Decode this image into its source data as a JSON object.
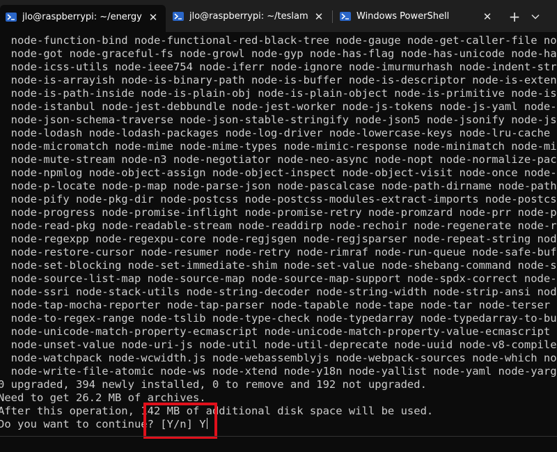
{
  "tabs": [
    {
      "title": "jlo@raspberrypi: ~/energyboa",
      "icon": "powershell-icon",
      "active": true
    },
    {
      "title": "jlo@raspberrypi: ~/teslamate",
      "icon": "powershell-icon",
      "active": false
    },
    {
      "title": "Windows PowerShell",
      "icon": "powershell-icon",
      "active": false
    }
  ],
  "tab_controls": {
    "new_tab": "+",
    "dropdown": "chevron-down-icon",
    "close": "✕"
  },
  "terminal": {
    "lines": [
      "  node-function-bind node-functional-red-black-tree node-gauge node-get-caller-file node-g",
      "  node-got node-graceful-fs node-growl node-gyp node-has-flag node-has-unicode node-has-va",
      "  node-icss-utils node-ieee754 node-iferr node-ignore node-imurmurhash node-indent-string",
      "  node-is-arrayish node-is-binary-path node-is-buffer node-is-descriptor node-is-extendabl",
      "  node-is-path-inside node-is-plain-obj node-is-plain-object node-is-primitive node-is-st",
      "  node-istanbul node-jest-debbundle node-jest-worker node-js-tokens node-js-yaml node-jse",
      "  node-json-schema-traverse node-json-stable-stringify node-json5 node-jsonify node-jsonp",
      "  node-lodash node-lodash-packages node-log-driver node-lowercase-keys node-lru-cache nod",
      "  node-micromatch node-mime node-mime-types node-mimic-response node-minimatch node-minim",
      "  node-mute-stream node-n3 node-negotiator node-neo-async node-nopt node-normalize-packag",
      "  node-npmlog node-object-assign node-object-inspect node-object-visit node-once node-ope",
      "  node-p-locate node-p-map node-parse-json node-pascalcase node-path-dirname node-path-ex",
      "  node-pify node-pkg-dir node-postcss node-postcss-modules-extract-imports node-postcss-m",
      "  node-progress node-promise-inflight node-promise-retry node-promzard node-prr node-pump",
      "  node-read-pkg node-readable-stream node-readdirp node-rechoir node-regenerate node-rege",
      "  node-regexpp node-regexpu-core node-regjsgen node-regjsparser node-repeat-string node-r",
      "  node-restore-cursor node-resumer node-retry node-rimraf node-run-queue node-safe-buffer",
      "  node-set-blocking node-set-immediate-shim node-set-value node-shebang-command node-sheb",
      "  node-source-list-map node-source-map node-source-map-support node-spdx-correct node-spd",
      "  node-ssri node-stack-utils node-string-decoder node-string-width node-strip-ansi node-s",
      "  node-tap-mocha-reporter node-tap-parser node-tapable node-tape node-tar node-terser nod",
      "  node-to-regex-range node-tslib node-type-check node-typedarray node-typedarray-to-buffe",
      "  node-unicode-match-property-ecmascript node-unicode-match-property-value-ecmascript nod",
      "  node-unset-value node-uri-js node-util node-util-deprecate node-uuid node-v8-compile-ca",
      "  node-watchpack node-wcwidth.js node-webassemblyjs node-webpack-sources node-which node-",
      "  node-write-file-atomic node-ws node-xtend node-y18n node-yallist node-yaml node-yargs n",
      "0 upgraded, 394 newly installed, 0 to remove and 192 not upgraded.",
      "Need to get 26.2 MB of archives.",
      "After this operation, 142 MB of additional disk space will be used.",
      "Do you want to continue? [Y/n] Y"
    ]
  },
  "colors": {
    "terminal_bg": "#0c0c0c",
    "terminal_fg": "#cccccc",
    "tabbar_bg": "#1f1f1f",
    "highlight": "#e0101b",
    "powershell_icon": "#2a66c8"
  }
}
